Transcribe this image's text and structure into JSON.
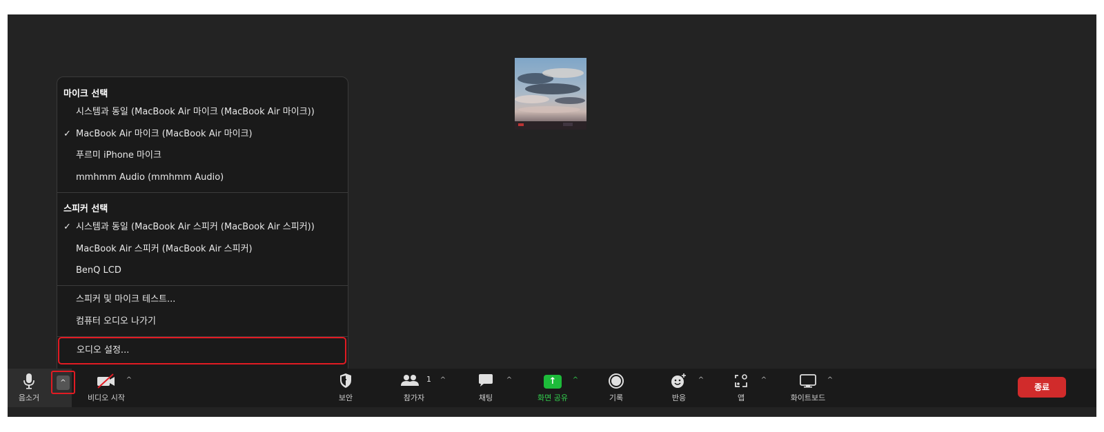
{
  "menu": {
    "mic_header": "마이크 선택",
    "mic_items": [
      {
        "label": "시스템과 동일 (MacBook Air 마이크 (MacBook Air 마이크))",
        "checked": false
      },
      {
        "label": "MacBook Air 마이크 (MacBook Air 마이크)",
        "checked": true
      },
      {
        "label": "푸르미 iPhone 마이크",
        "checked": false
      },
      {
        "label": "mmhmm Audio (mmhmm Audio)",
        "checked": false
      }
    ],
    "speaker_header": "스피커 선택",
    "speaker_items": [
      {
        "label": "시스템과 동일 (MacBook Air 스피커 (MacBook Air 스피커))",
        "checked": true
      },
      {
        "label": "MacBook Air 스피커 (MacBook Air 스피커)",
        "checked": false
      },
      {
        "label": "BenQ LCD",
        "checked": false
      }
    ],
    "test_label": "스피커 및 마이크 테스트...",
    "leave_audio_label": "컴퓨터 오디오 나가기",
    "audio_settings_label": "오디오 설정...",
    "check_glyph": "✓"
  },
  "toolbar": {
    "mute_label": "음소거",
    "video_label": "비디오 시작",
    "security_label": "보안",
    "participants_label": "참가자",
    "participants_count": "1",
    "chat_label": "채팅",
    "share_label": "화면 공유",
    "record_label": "기록",
    "reactions_label": "반응",
    "apps_label": "앱",
    "whiteboard_label": "화이트보드",
    "end_label": "종료",
    "caret_glyph": "^",
    "share_arrow": "↑"
  },
  "colors": {
    "accent_red": "#e21b23",
    "share_green": "#1dbb3a",
    "end_red": "#d12b2b",
    "background": "#232323"
  },
  "icons": [
    "microphone-icon",
    "video-off-icon",
    "shield-icon",
    "participants-icon",
    "chat-icon",
    "share-screen-icon",
    "record-icon",
    "reactions-icon",
    "apps-icon",
    "whiteboard-icon"
  ]
}
